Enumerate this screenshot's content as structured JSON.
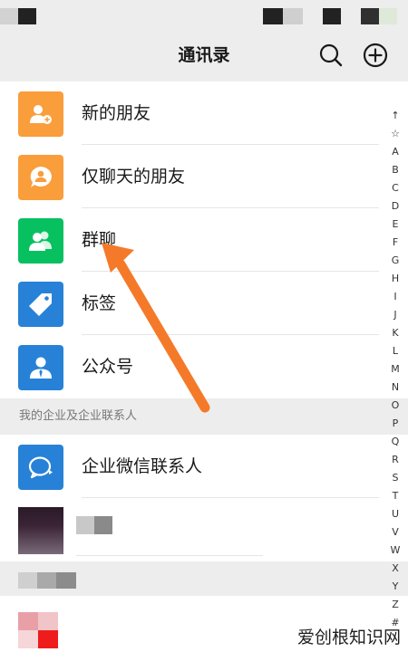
{
  "header": {
    "title": "通讯录",
    "search_icon": "search-icon",
    "add_icon": "plus-circle-icon"
  },
  "contacts_menu": {
    "items": [
      {
        "label": "新的朋友",
        "icon": "add-friend-icon",
        "color": "#fa9d3b"
      },
      {
        "label": "仅聊天的朋友",
        "icon": "chat-only-icon",
        "color": "#fa9d3b"
      },
      {
        "label": "群聊",
        "icon": "group-chat-icon",
        "color": "#07c160"
      },
      {
        "label": "标签",
        "icon": "tag-icon",
        "color": "#2782d7"
      },
      {
        "label": "公众号",
        "icon": "official-account-icon",
        "color": "#2782d7"
      }
    ]
  },
  "enterprise": {
    "section_label": "我的企业及企业联系人",
    "item_label": "企业微信联系人",
    "item_icon": "enterprise-contact-icon",
    "color": "#2782d7"
  },
  "alphabet_index": [
    "↑",
    "☆",
    "A",
    "B",
    "C",
    "D",
    "E",
    "F",
    "G",
    "H",
    "I",
    "J",
    "K",
    "L",
    "M",
    "N",
    "O",
    "P",
    "Q",
    "R",
    "S",
    "T",
    "U",
    "V",
    "W",
    "X",
    "Y",
    "Z",
    "#"
  ],
  "annotation": {
    "arrow_color": "#f47a2a"
  },
  "watermark": "爱创根知识网"
}
